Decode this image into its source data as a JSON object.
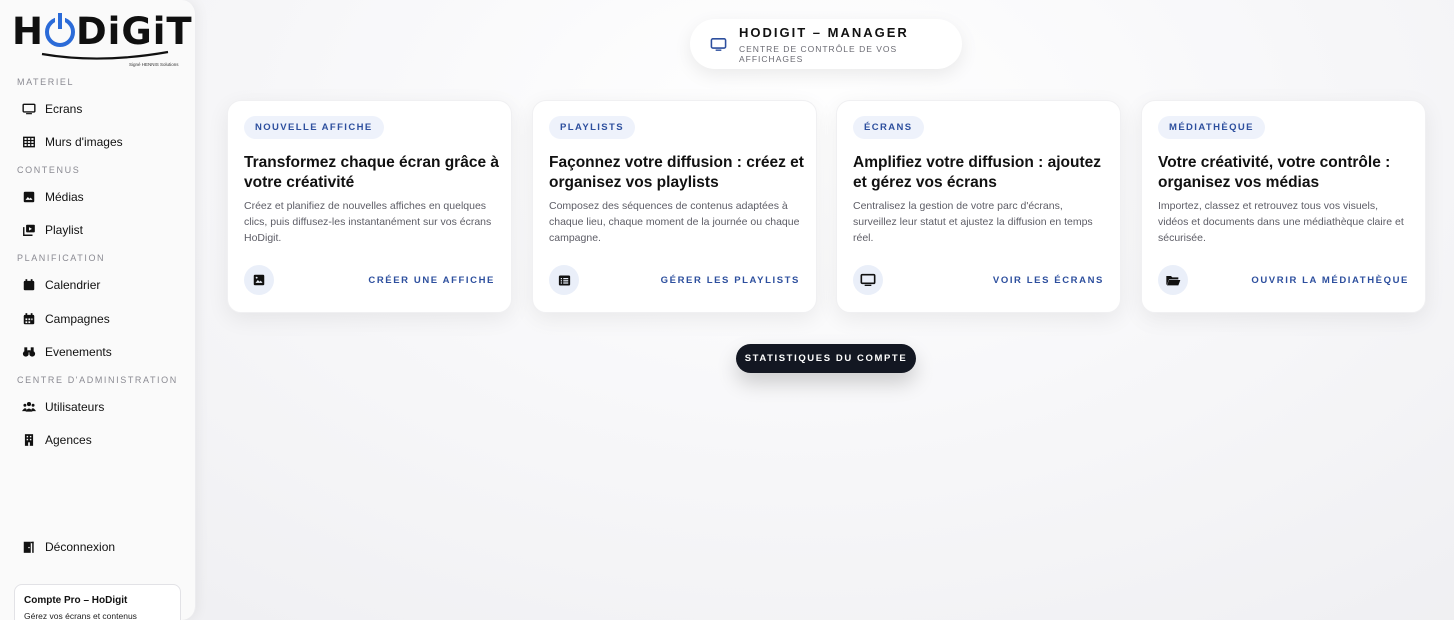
{
  "sidebar": {
    "logo": {
      "text_left": "H",
      "text_right": "DiGiT",
      "tagline": "Signé HENNIS Solutions"
    },
    "sections": [
      {
        "label": "MATERIEL"
      },
      {
        "label": "CONTENUS"
      },
      {
        "label": "PLANIFICATION"
      },
      {
        "label": "CENTRE D'ADMINISTRATION"
      }
    ],
    "items": [
      {
        "label": "Ecrans",
        "icon": "monitor-icon"
      },
      {
        "label": "Murs d'images",
        "icon": "grid-icon"
      },
      {
        "label": "Médias",
        "icon": "image-icon"
      },
      {
        "label": "Playlist",
        "icon": "playlist-icon"
      },
      {
        "label": "Calendrier",
        "icon": "calendar-icon"
      },
      {
        "label": "Campagnes",
        "icon": "calendar-grid-icon"
      },
      {
        "label": "Evenements",
        "icon": "binoculars-icon"
      },
      {
        "label": "Utilisateurs",
        "icon": "users-icon"
      },
      {
        "label": "Agences",
        "icon": "building-icon"
      }
    ],
    "logout": {
      "label": "Déconnexion",
      "icon": "door-exit-icon"
    },
    "account": {
      "title": "Compte Pro – HoDigit",
      "subtitle": "Gérez vos écrans et contenus"
    }
  },
  "header": {
    "title": "HODIGIT – MANAGER",
    "subtitle": "CENTRE DE CONTRÔLE DE VOS AFFICHAGES",
    "icon": "monitor-icon"
  },
  "cards": [
    {
      "badge": "NOUVELLE AFFICHE",
      "title": "Transformez chaque écran grâce à votre créativité",
      "description": "Créez et planifiez de nouvelles affiches en quelques clics, puis diffusez-les instantanément sur vos écrans HoDigit.",
      "icon": "image-icon",
      "link": "CRÉER UNE AFFICHE"
    },
    {
      "badge": "PLAYLISTS",
      "title": "Façonnez votre diffusion : créez et organisez vos playlists",
      "description": "Composez des séquences de contenus adaptées à chaque lieu, chaque moment de la journée ou chaque campagne.",
      "icon": "list-icon",
      "link": "GÉRER LES PLAYLISTS"
    },
    {
      "badge": "ÉCRANS",
      "title": "Amplifiez votre diffusion : ajoutez et gérez vos écrans",
      "description": "Centralisez la gestion de votre parc d'écrans, surveillez leur statut et ajustez la diffusion en temps réel.",
      "icon": "monitor-icon",
      "link": "VOIR LES ÉCRANS"
    },
    {
      "badge": "MÉDIATHÈQUE",
      "title": "Votre créativité, votre contrôle : organisez vos médias",
      "description": "Importez, classez et retrouvez tous vos visuels, vidéos et documents dans une médiathèque claire et sécurisée.",
      "icon": "folder-icon",
      "link": "OUVRIR LA MÉDIATHÈQUE"
    }
  ],
  "stats_button": {
    "label": "STATISTIQUES DU COMPTE"
  },
  "colors": {
    "accent": "#2d4f9e",
    "logo_blue": "#2b6bd8",
    "dark_button": "#131722",
    "badge_bg": "#eef2fb"
  }
}
